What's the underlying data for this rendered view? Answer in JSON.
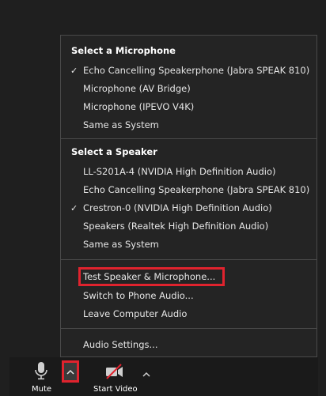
{
  "microphone": {
    "title": "Select a Microphone",
    "items": [
      {
        "label": "Echo Cancelling Speakerphone (Jabra SPEAK 810)",
        "checked": true
      },
      {
        "label": "Microphone (AV Bridge)",
        "checked": false
      },
      {
        "label": "Microphone (IPEVO V4K)",
        "checked": false
      },
      {
        "label": "Same as System",
        "checked": false
      }
    ]
  },
  "speaker": {
    "title": "Select a Speaker",
    "items": [
      {
        "label": "LL-S201A-4 (NVIDIA High Definition Audio)",
        "checked": false
      },
      {
        "label": "Echo Cancelling Speakerphone (Jabra SPEAK 810)",
        "checked": false
      },
      {
        "label": "Crestron-0 (NVIDIA High Definition Audio)",
        "checked": true
      },
      {
        "label": "Speakers (Realtek High Definition Audio)",
        "checked": false
      },
      {
        "label": "Same as System",
        "checked": false
      }
    ]
  },
  "actions": {
    "test": "Test Speaker & Microphone...",
    "switch_phone": "Switch to Phone Audio...",
    "leave": "Leave Computer Audio"
  },
  "settings": "Audio Settings...",
  "check_glyph": "✓",
  "toolbar": {
    "mute": "Mute",
    "start_video": "Start Video"
  },
  "colors": {
    "highlight": "#e0232e",
    "video_off": "#e0232e"
  }
}
